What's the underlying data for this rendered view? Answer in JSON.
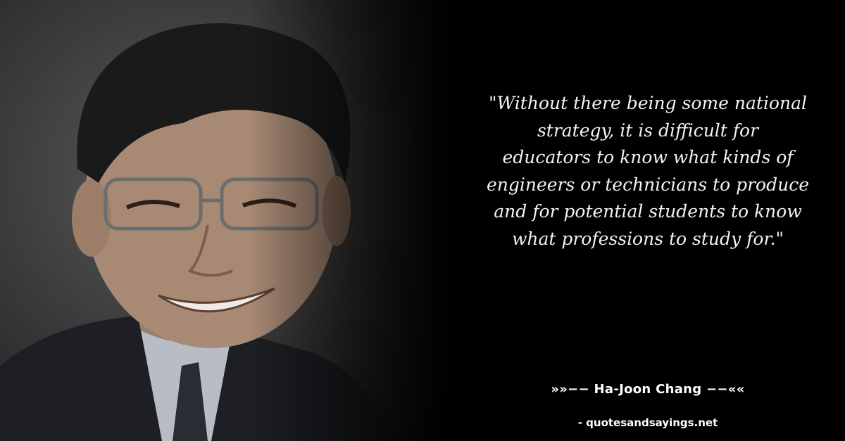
{
  "quote": {
    "lines": [
      "\"Without there being some national",
      "strategy, it is difficult for",
      "educators to know what kinds of",
      "engineers or technicians to produce",
      "and for potential students to know",
      "what professions to study for.\""
    ]
  },
  "author": {
    "label": "»»−− Ha-Joon Chang −−««"
  },
  "source": {
    "label": "- quotesandsayings.net"
  },
  "colors": {
    "background": "#000000",
    "text": "#ffffff"
  }
}
